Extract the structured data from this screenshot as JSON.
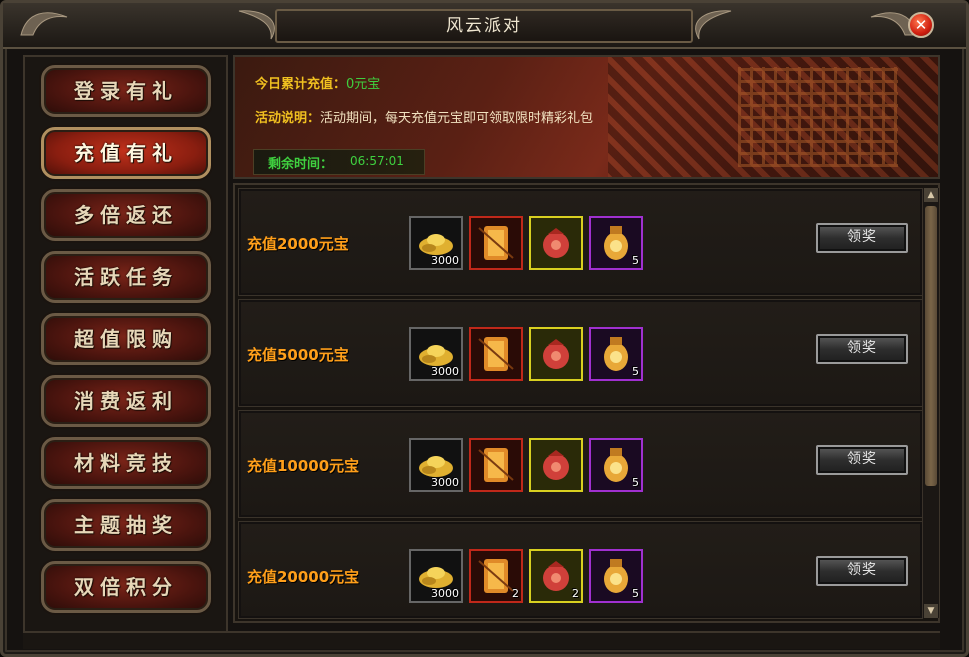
{
  "window": {
    "title": "风云派对",
    "close_glyph": "✕"
  },
  "nav": {
    "items": [
      {
        "label": "登录有礼",
        "active": false
      },
      {
        "label": "充值有礼",
        "active": true
      },
      {
        "label": "多倍返还",
        "active": false
      },
      {
        "label": "活跃任务",
        "active": false
      },
      {
        "label": "超值限购",
        "active": false
      },
      {
        "label": "消费返利",
        "active": false
      },
      {
        "label": "材料竞技",
        "active": false
      },
      {
        "label": "主题抽奖",
        "active": false
      },
      {
        "label": "双倍积分",
        "active": false
      }
    ]
  },
  "banner": {
    "recharge_label": "今日累计充值：",
    "recharge_value": "0元宝",
    "desc_label": "活动说明：",
    "desc_text": "活动期间，每天充值元宝即可领取限时精彩礼包",
    "time_label": "剩余时间：",
    "time_value": "06:57:01"
  },
  "rewards": [
    {
      "title": "充值2000元宝",
      "items": [
        {
          "icon": "gold-ingot-icon",
          "count": "3000"
        },
        {
          "icon": "scroll-icon",
          "count": ""
        },
        {
          "icon": "red-pouch-icon",
          "count": ""
        },
        {
          "icon": "token-bag-icon",
          "count": "5"
        }
      ],
      "button": "领奖"
    },
    {
      "title": "充值5000元宝",
      "items": [
        {
          "icon": "gold-ingot-icon",
          "count": "3000"
        },
        {
          "icon": "scroll-icon",
          "count": ""
        },
        {
          "icon": "red-pouch-icon",
          "count": ""
        },
        {
          "icon": "token-bag-icon",
          "count": "5"
        }
      ],
      "button": "领奖"
    },
    {
      "title": "充值10000元宝",
      "items": [
        {
          "icon": "gold-ingot-icon",
          "count": "3000"
        },
        {
          "icon": "scroll-icon",
          "count": ""
        },
        {
          "icon": "red-pouch-icon",
          "count": ""
        },
        {
          "icon": "token-bag-icon",
          "count": "5"
        }
      ],
      "button": "领奖"
    },
    {
      "title": "充值20000元宝",
      "items": [
        {
          "icon": "gold-ingot-icon",
          "count": "3000"
        },
        {
          "icon": "scroll-icon",
          "count": "2"
        },
        {
          "icon": "red-pouch-icon",
          "count": "2"
        },
        {
          "icon": "token-bag-icon",
          "count": "5"
        }
      ],
      "button": "领奖"
    }
  ],
  "scrollbar": {
    "up": "▲",
    "down": "▼"
  },
  "colors": {
    "accent_orange": "#ff9f1a",
    "label_yellow": "#f0c020",
    "value_green": "#3fd03f",
    "close_red": "#d11f10"
  }
}
